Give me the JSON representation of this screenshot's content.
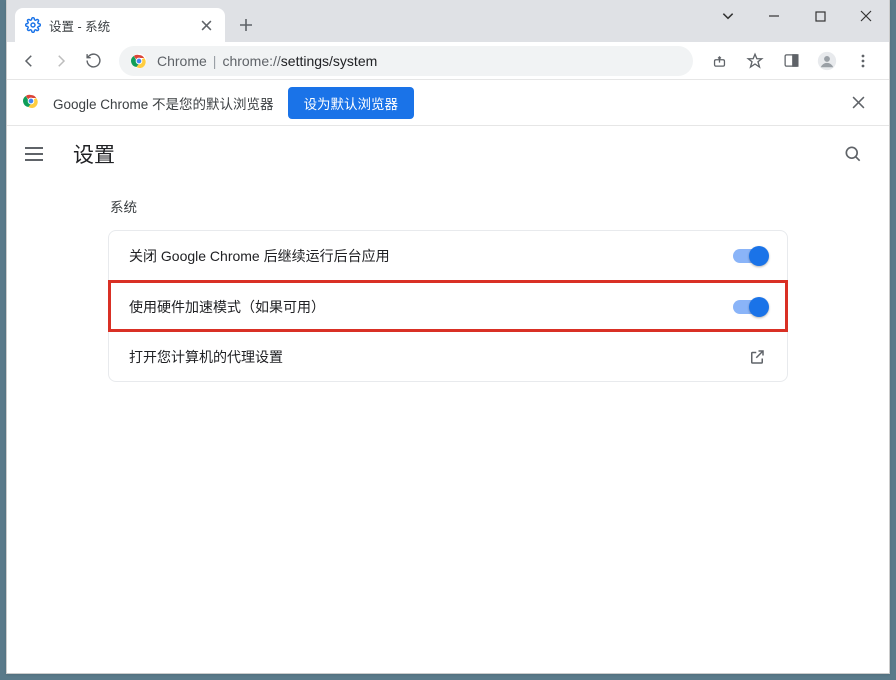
{
  "tab": {
    "title": "设置 - 系统"
  },
  "address": {
    "source_label": "Chrome",
    "scheme": "chrome://",
    "path": "settings/system"
  },
  "infobar": {
    "message": "Google Chrome 不是您的默认浏览器",
    "button": "设为默认浏览器"
  },
  "header": {
    "title": "设置"
  },
  "section": {
    "title": "系统",
    "rows": [
      {
        "label": "关闭 Google Chrome 后继续运行后台应用",
        "type": "toggle",
        "value": true
      },
      {
        "label": "使用硬件加速模式（如果可用）",
        "type": "toggle",
        "value": true,
        "highlight": true
      },
      {
        "label": "打开您计算机的代理设置",
        "type": "link"
      }
    ]
  }
}
